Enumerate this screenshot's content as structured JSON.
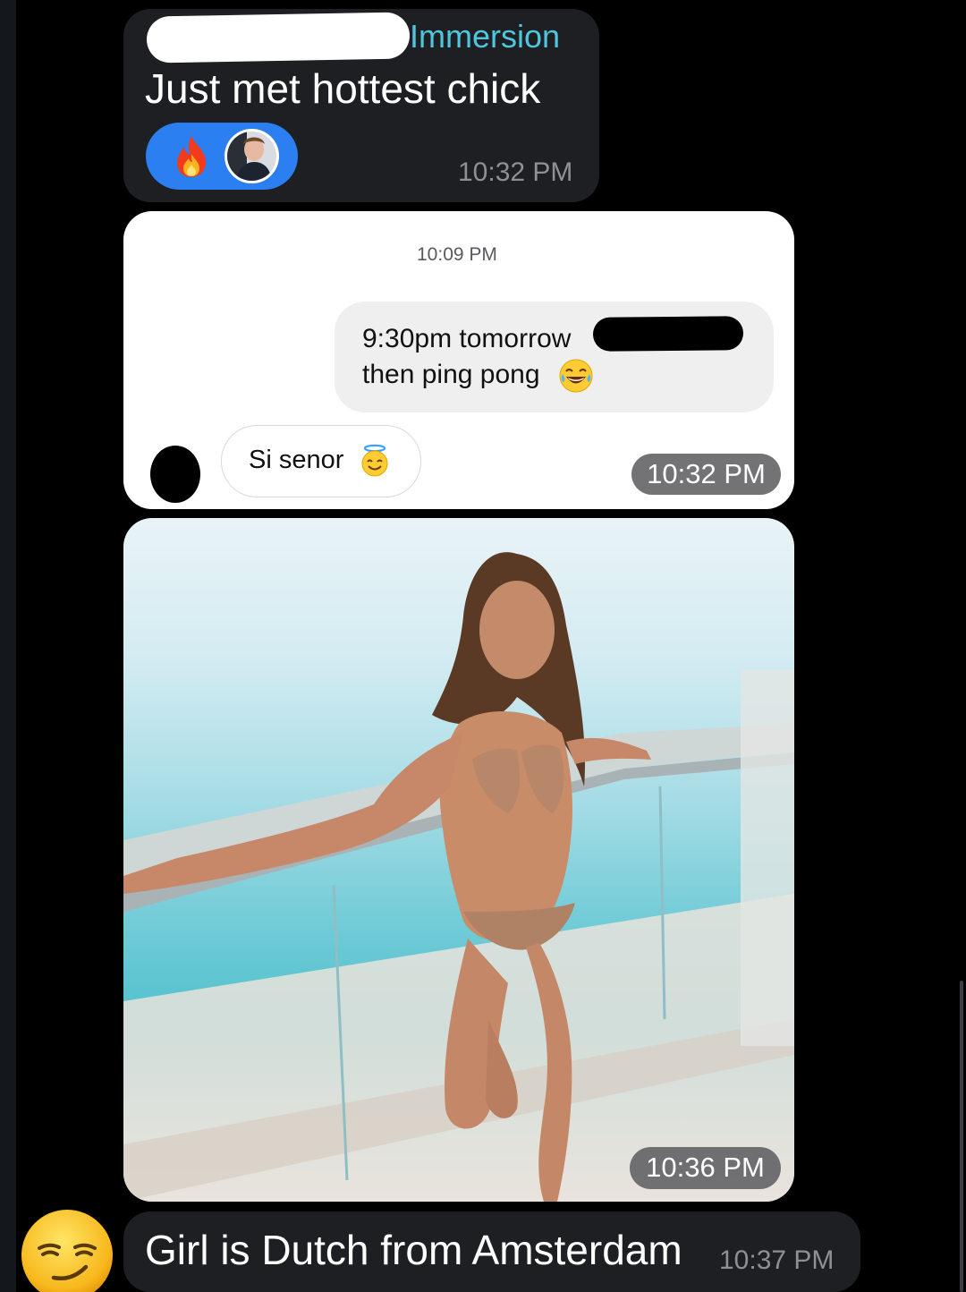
{
  "messages": [
    {
      "sender": "Immersion",
      "text": "Just met hottest chick",
      "reactions": [
        "fire-icon",
        "reactor-avatar"
      ],
      "time": "10:32 PM"
    },
    {
      "type": "screenshot",
      "screenshot": {
        "time_header": "10:09 PM",
        "sent_line1": "9:30pm tomorrow",
        "sent_line2": "then ping pong",
        "sent_emoji": "laughing-icon",
        "received_text": "Si senor",
        "received_emoji": "angel-icon"
      },
      "time": "10:32 PM"
    },
    {
      "type": "photo",
      "time": "10:36 PM"
    },
    {
      "text": "Girl is Dutch from Amsterdam",
      "avatar": "smirk-icon",
      "time": "10:37 PM"
    }
  ],
  "colors": {
    "background": "#000000",
    "bubble": "#1d1f22",
    "sender_name": "#4fc6de",
    "reaction_pill": "#2b7ff0",
    "timestamp": "#8d9096"
  }
}
